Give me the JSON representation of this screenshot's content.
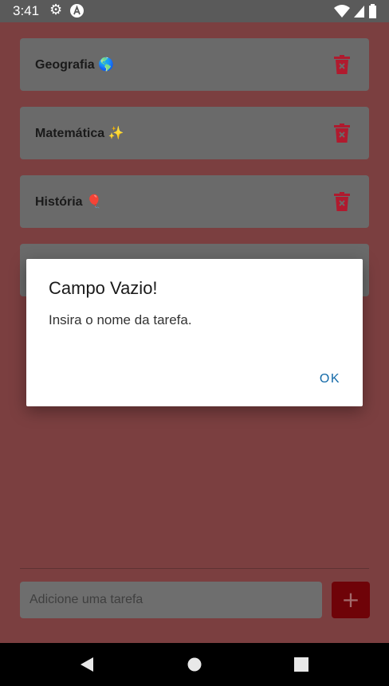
{
  "status_bar": {
    "time": "3:41",
    "icons": [
      "gear-icon",
      "app-a-icon",
      "wifi-icon",
      "signal-icon",
      "battery-icon"
    ]
  },
  "tasks": [
    {
      "label": "Geografia",
      "emoji": "🌎",
      "delete_icon": "trash-icon"
    },
    {
      "label": "Matemática",
      "emoji": "✨",
      "delete_icon": "trash-icon"
    },
    {
      "label": "História",
      "emoji": "🎈",
      "delete_icon": "trash-icon"
    }
  ],
  "add_task": {
    "placeholder": "Adicione uma tarefa",
    "button_label": "+"
  },
  "dialog": {
    "title": "Campo Vazio!",
    "message": "Insira o nome da tarefa.",
    "ok_label": "OK"
  },
  "nav_bar": {
    "buttons": [
      "back-icon",
      "home-icon",
      "recents-icon"
    ]
  },
  "colors": {
    "accent_red": "#d11a2a",
    "dialog_button": "#136aa8",
    "overlay_bg": "#7b3f40"
  }
}
